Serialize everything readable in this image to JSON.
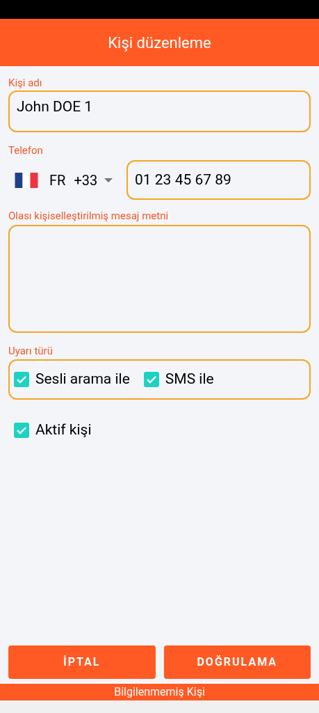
{
  "header": {
    "title": "Kişi düzenleme"
  },
  "name_field": {
    "label": "Kişi adı",
    "value": "John DOE 1"
  },
  "phone": {
    "label": "Telefon",
    "country": "FR",
    "dial_code": "+33",
    "value": "01 23 45 67 89"
  },
  "message_field": {
    "label": "Olası kişiselleştirilmiş mesaj metni"
  },
  "alert_type": {
    "label": "Uyarı türü",
    "options": [
      {
        "label": "Sesli arama ile",
        "checked": true
      },
      {
        "label": "SMS ile",
        "checked": true
      }
    ]
  },
  "active_contact": {
    "label": "Aktif kişi",
    "checked": true
  },
  "buttons": [
    "İPTAL",
    "DOĞRULAMA"
  ],
  "footer": {
    "text": "Bilgilenmemiş Kişi"
  }
}
